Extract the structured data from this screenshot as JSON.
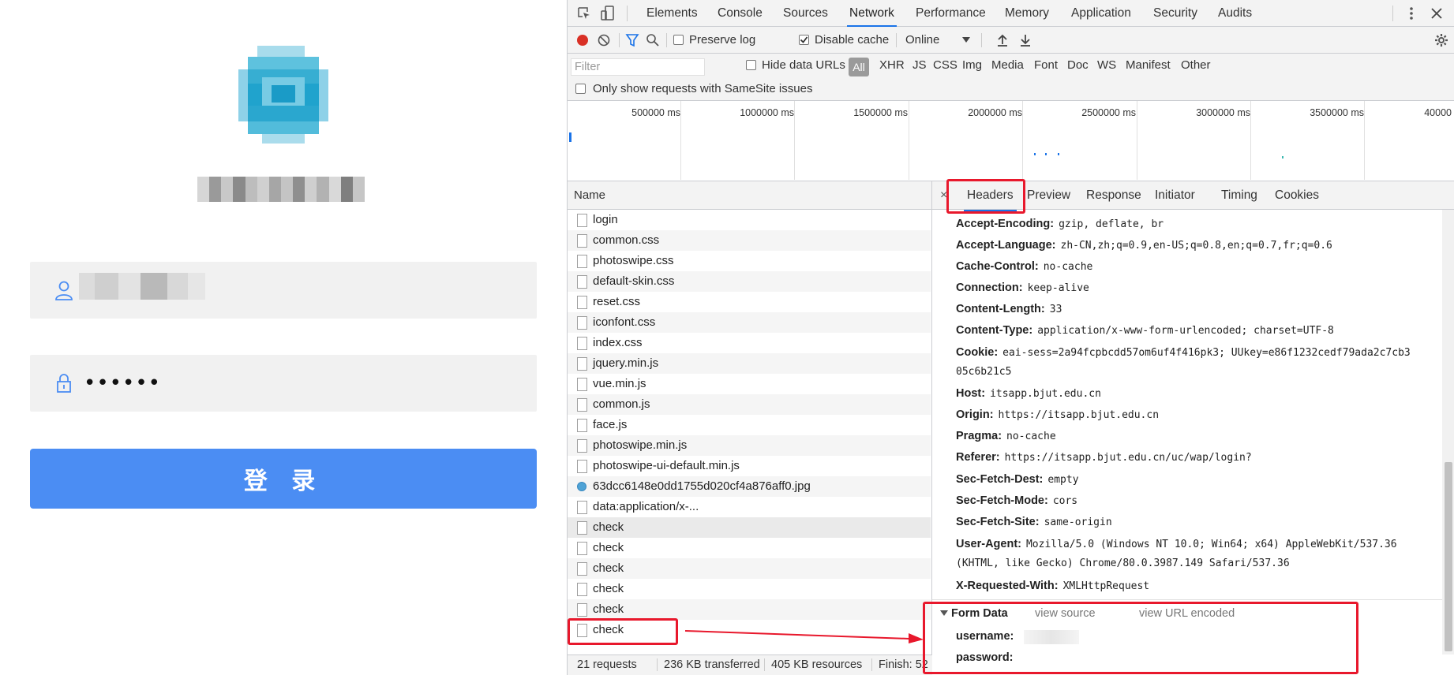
{
  "login": {
    "password_mask": "••••••",
    "button_label": "登 录"
  },
  "devtools": {
    "panel_tabs": [
      "Elements",
      "Console",
      "Sources",
      "Network",
      "Performance",
      "Memory",
      "Application",
      "Security",
      "Audits"
    ],
    "active_panel": "Network",
    "toolbar": {
      "preserve_log": "Preserve log",
      "disable_cache": "Disable cache",
      "throttle": "Online"
    },
    "filter": {
      "placeholder": "Filter",
      "hide_data_urls": "Hide data URLs",
      "types": [
        "All",
        "XHR",
        "JS",
        "CSS",
        "Img",
        "Media",
        "Font",
        "Doc",
        "WS",
        "Manifest",
        "Other"
      ],
      "samesite": "Only show requests with SameSite issues"
    },
    "timeline_ticks": [
      "500000 ms",
      "1000000 ms",
      "1500000 ms",
      "2000000 ms",
      "2500000 ms",
      "3000000 ms",
      "3500000 ms",
      "40000"
    ],
    "name_header": "Name",
    "requests": [
      "login",
      "common.css",
      "photoswipe.css",
      "default-skin.css",
      "reset.css",
      "iconfont.css",
      "index.css",
      "jquery.min.js",
      "vue.min.js",
      "common.js",
      "face.js",
      "photoswipe.min.js",
      "photoswipe-ui-default.min.js",
      "63dcc6148e0dd1755d020cf4a876aff0.jpg",
      "data:application/x-...",
      "check",
      "check",
      "check",
      "check",
      "check",
      "check"
    ],
    "detail_tabs": [
      "Headers",
      "Preview",
      "Response",
      "Initiator",
      "Timing",
      "Cookies"
    ],
    "close_icon": "×",
    "headers": [
      {
        "k": "Accept-Encoding:",
        "v": "gzip, deflate, br"
      },
      {
        "k": "Accept-Language:",
        "v": "zh-CN,zh;q=0.9,en-US;q=0.8,en;q=0.7,fr;q=0.6"
      },
      {
        "k": "Cache-Control:",
        "v": "no-cache"
      },
      {
        "k": "Connection:",
        "v": "keep-alive"
      },
      {
        "k": "Content-Length:",
        "v": "33"
      },
      {
        "k": "Content-Type:",
        "v": "application/x-www-form-urlencoded; charset=UTF-8"
      },
      {
        "k": "Cookie:",
        "v": "eai-sess=2a94fcpbcdd57om6uf4f416pk3; UUkey=e86f1232cedf79ada2c7cb3"
      },
      {
        "k": "Host:",
        "v": "itsapp.bjut.edu.cn"
      },
      {
        "k": "Origin:",
        "v": "https://itsapp.bjut.edu.cn"
      },
      {
        "k": "Pragma:",
        "v": "no-cache"
      },
      {
        "k": "Referer:",
        "v": "https://itsapp.bjut.edu.cn/uc/wap/login?"
      },
      {
        "k": "Sec-Fetch-Dest:",
        "v": "empty"
      },
      {
        "k": "Sec-Fetch-Mode:",
        "v": "cors"
      },
      {
        "k": "Sec-Fetch-Site:",
        "v": "same-origin"
      },
      {
        "k": "User-Agent:",
        "v": "Mozilla/5.0 (Windows NT 10.0; Win64; x64) AppleWebKit/537.36"
      },
      {
        "k": "X-Requested-With:",
        "v": "XMLHttpRequest"
      }
    ],
    "cookie_cont": "05c6b21c5",
    "ua_cont": "(KHTML, like Gecko) Chrome/80.0.3987.149 Safari/537.36",
    "form_data": {
      "title": "Form Data",
      "view_source": "view source",
      "view_url": "view URL encoded",
      "username_label": "username:",
      "password_label": "password:"
    },
    "status": {
      "requests": "21 requests",
      "transferred": "236 KB transferred",
      "resources": "405 KB resources",
      "finish": "Finish: 52"
    }
  },
  "colors": {
    "accent": "#1a73e8",
    "login_button": "#4b8df3",
    "annotation_red": "#e8182c",
    "record": "#d93025"
  }
}
